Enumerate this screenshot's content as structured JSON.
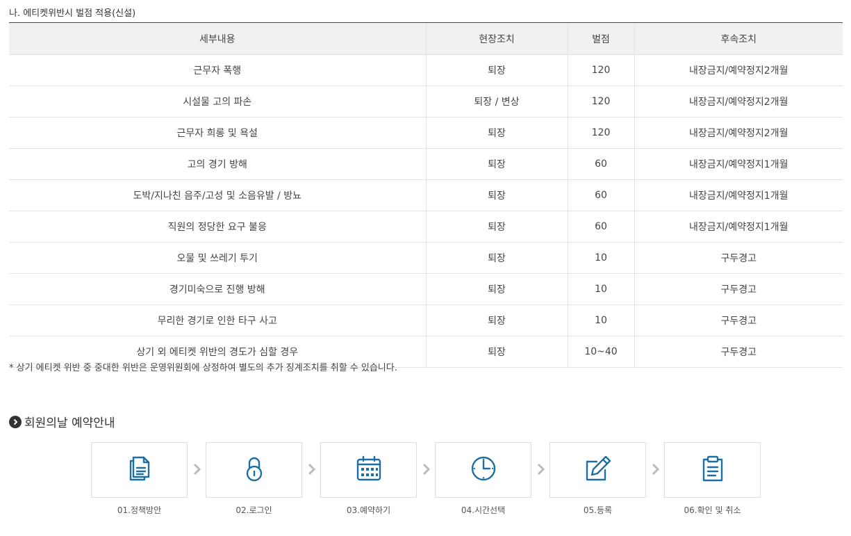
{
  "subtitle": "나. 에티켓위반시 벌점 적용(신설)",
  "table": {
    "headers": [
      "세부내용",
      "현장조치",
      "벌점",
      "후속조치"
    ],
    "rows": [
      [
        "근무자 폭행",
        "퇴장",
        "120",
        "내장금지/예약정지2개월"
      ],
      [
        "시설물 고의 파손",
        "퇴장 / 변상",
        "120",
        "내장금지/예약정지2개월"
      ],
      [
        "근무자 희롱 및 욕설",
        "퇴장",
        "120",
        "내장금지/예약정지2개월"
      ],
      [
        "고의 경기 방해",
        "퇴장",
        "60",
        "내장금지/예약정지1개월"
      ],
      [
        "도박/지나친 음주/고성 및 소음유발 / 방뇨",
        "퇴장",
        "60",
        "내장금지/예약정지1개월"
      ],
      [
        "직원의 정당한 요구 불응",
        "퇴장",
        "60",
        "내장금지/예약정지1개월"
      ],
      [
        "오물 및 쓰레기 투기",
        "퇴장",
        "10",
        "구두경고"
      ],
      [
        "경기미숙으로 진행 방해",
        "퇴장",
        "10",
        "구두경고"
      ],
      [
        "무리한 경기로 인한 타구 사고",
        "퇴장",
        "10",
        "구두경고"
      ],
      [
        "상기 외 에티켓 위반의 경도가 심할 경우",
        "퇴장",
        "10~40",
        "구두경고"
      ]
    ]
  },
  "note": "* 상기 에티켓 위반 중 중대한 위반은 운영위원회에 상정하여 별도의 추가 징계조치를 취할 수 있습니다.",
  "section_title": "회원의날 예약안내",
  "section_icon": "chevron-right-circle-icon",
  "steps": [
    {
      "label": "01.정책방안",
      "icon": "documents-icon"
    },
    {
      "label": "02.로그인",
      "icon": "padlock-icon"
    },
    {
      "label": "03.예약하기",
      "icon": "calendar-icon"
    },
    {
      "label": "04.시간선택",
      "icon": "clock-icon"
    },
    {
      "label": "05.등록",
      "icon": "edit-pen-icon"
    },
    {
      "label": "06.확인 및 취소",
      "icon": "clipboard-icon"
    }
  ],
  "colors": {
    "icon": "#1d6ea3",
    "header_bg": "#f1f1f1",
    "arrow": "#bbbbbb"
  }
}
